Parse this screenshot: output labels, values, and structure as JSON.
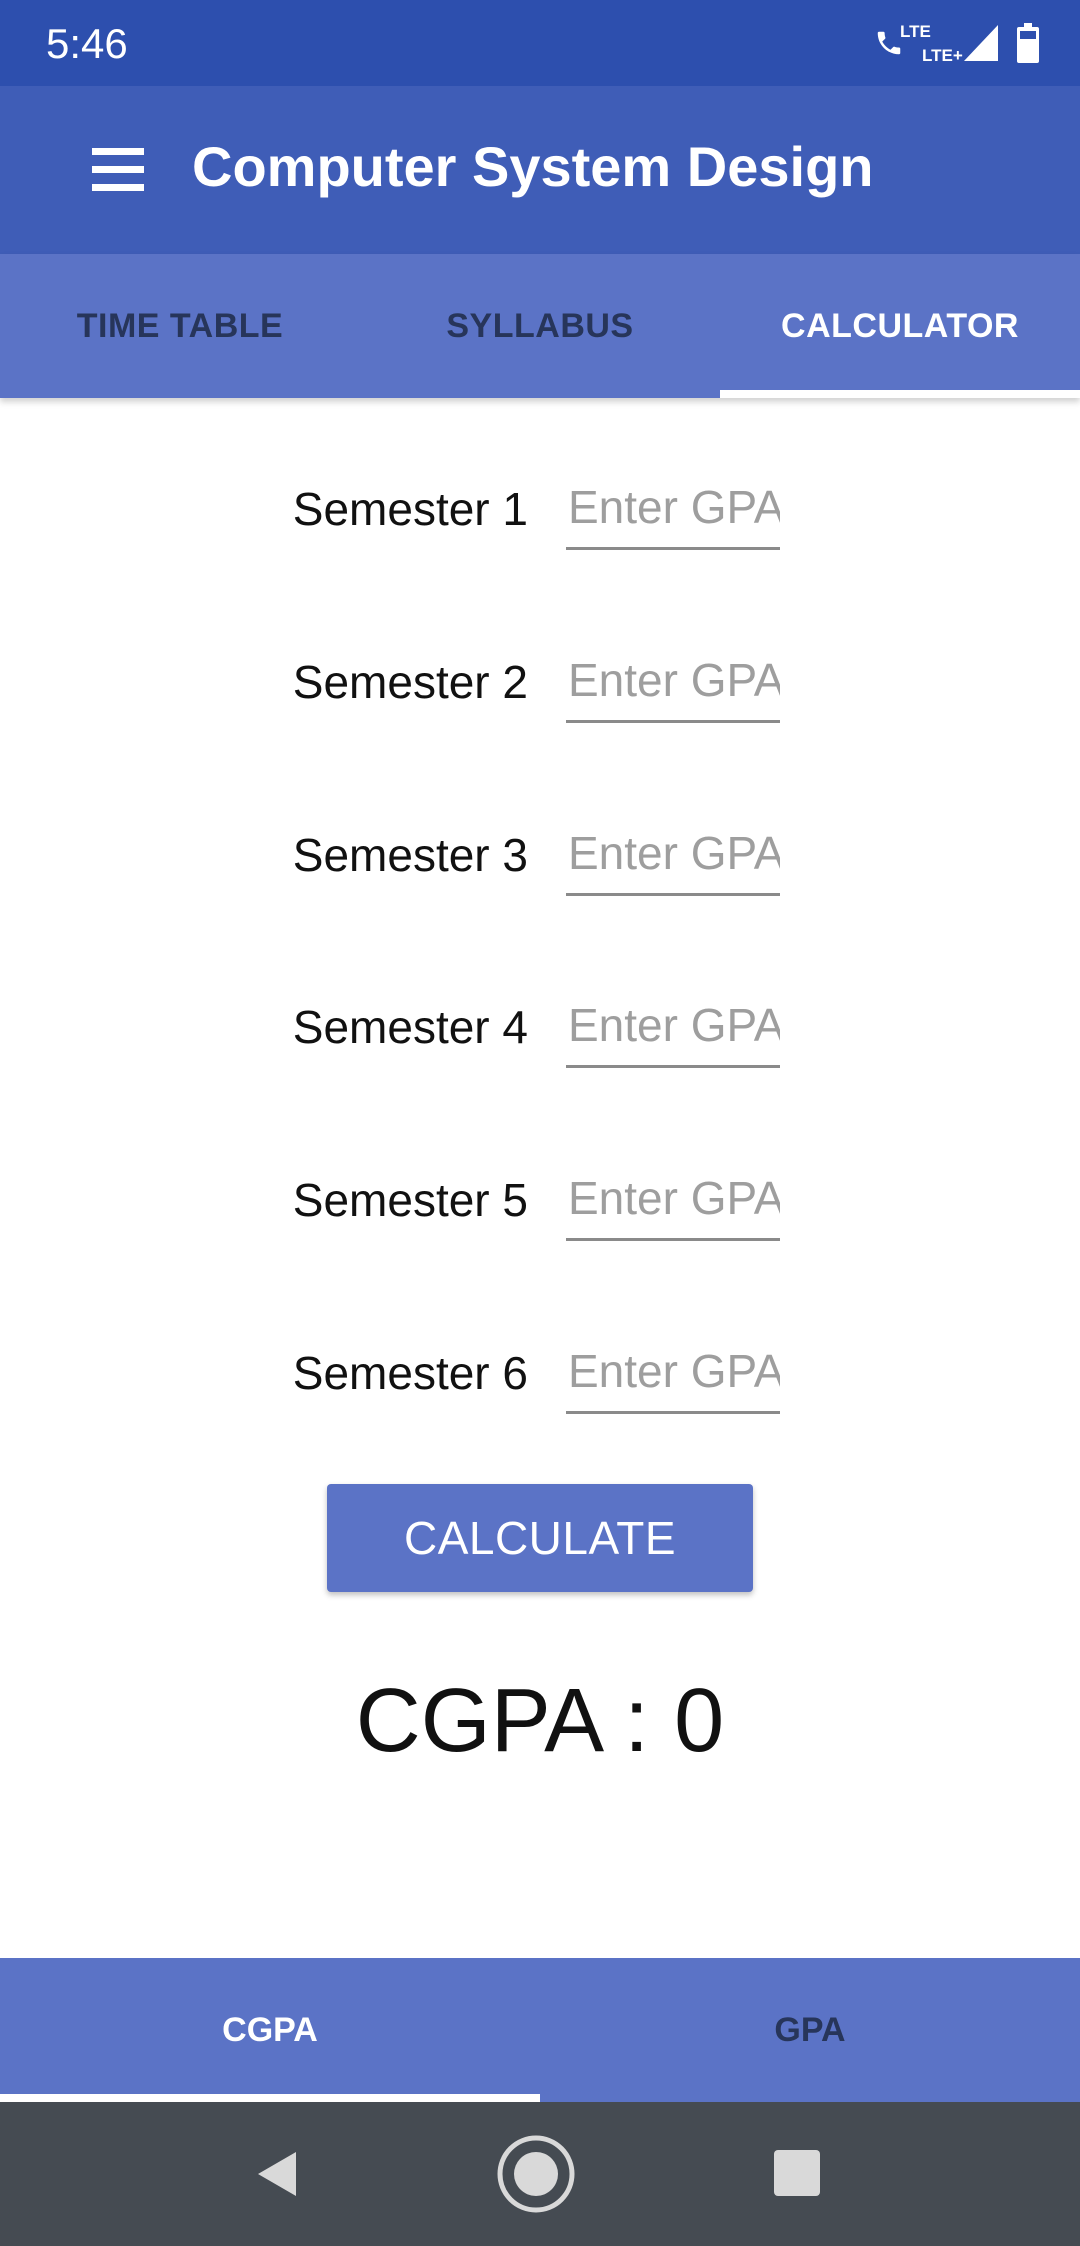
{
  "status_bar": {
    "time": "5:46",
    "network_primary": "LTE",
    "network_secondary": "LTE+"
  },
  "app_bar": {
    "title": "Computer System Design",
    "menu_icon": "hamburger-menu-icon"
  },
  "top_tabs": [
    {
      "label": "TIME TABLE",
      "active": false
    },
    {
      "label": "SYLLABUS",
      "active": false
    },
    {
      "label": "CALCULATOR",
      "active": true
    }
  ],
  "semesters": [
    {
      "label": "Semester 1",
      "value": "",
      "placeholder": "Enter GPA"
    },
    {
      "label": "Semester 2",
      "value": "",
      "placeholder": "Enter GPA"
    },
    {
      "label": "Semester 3",
      "value": "",
      "placeholder": "Enter GPA"
    },
    {
      "label": "Semester 4",
      "value": "",
      "placeholder": "Enter GPA"
    },
    {
      "label": "Semester 5",
      "value": "",
      "placeholder": "Enter GPA"
    },
    {
      "label": "Semester 6",
      "value": "",
      "placeholder": "Enter GPA"
    }
  ],
  "calculate_button": {
    "label": "CALCULATE"
  },
  "result": {
    "text": "CGPA : 0"
  },
  "bottom_tabs": [
    {
      "label": "CGPA",
      "active": true
    },
    {
      "label": "GPA",
      "active": false
    }
  ],
  "nav_bar": {
    "icons": [
      "back-icon",
      "home-icon",
      "recents-icon"
    ]
  },
  "colors": {
    "status_bar": "#2d4fae",
    "app_bar": "#3f5db7",
    "tab_bar": "#5b73c6",
    "inactive_tab_text": "#27355a",
    "nav_bar": "#454b52"
  }
}
